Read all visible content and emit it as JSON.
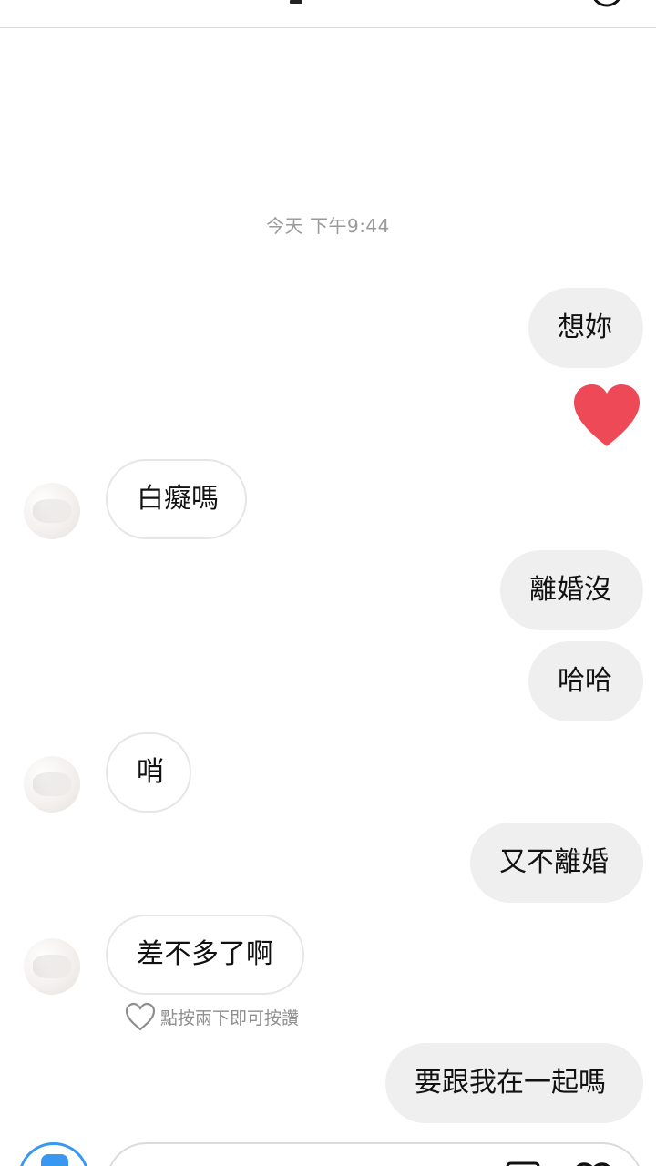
{
  "header": {
    "back_icon": "chevron-left-icon",
    "info_icon": "info-circle-icon"
  },
  "thread": {
    "timestamp": "今天 下午9:44",
    "messages": [
      {
        "direction": "outgoing",
        "text": "想妳"
      },
      {
        "direction": "outgoing",
        "type": "reaction",
        "icon": "heart-icon",
        "color": "#ed4956"
      },
      {
        "direction": "incoming",
        "text": "白癡嗎"
      },
      {
        "direction": "outgoing",
        "text": "離婚沒"
      },
      {
        "direction": "outgoing",
        "text": "哈哈"
      },
      {
        "direction": "incoming",
        "text": "哨"
      },
      {
        "direction": "outgoing",
        "text": "又不離婚"
      },
      {
        "direction": "incoming",
        "text": "差不多了啊"
      },
      {
        "direction": "outgoing",
        "text": "要跟我在一起嗎"
      }
    ],
    "like_hint": "點按兩下即可按讚"
  },
  "composer": {
    "camera_icon": "camera-icon",
    "gallery_icon": "gallery-icon",
    "heart_icon": "heart-outline-icon",
    "accent_color": "#3897f0"
  }
}
